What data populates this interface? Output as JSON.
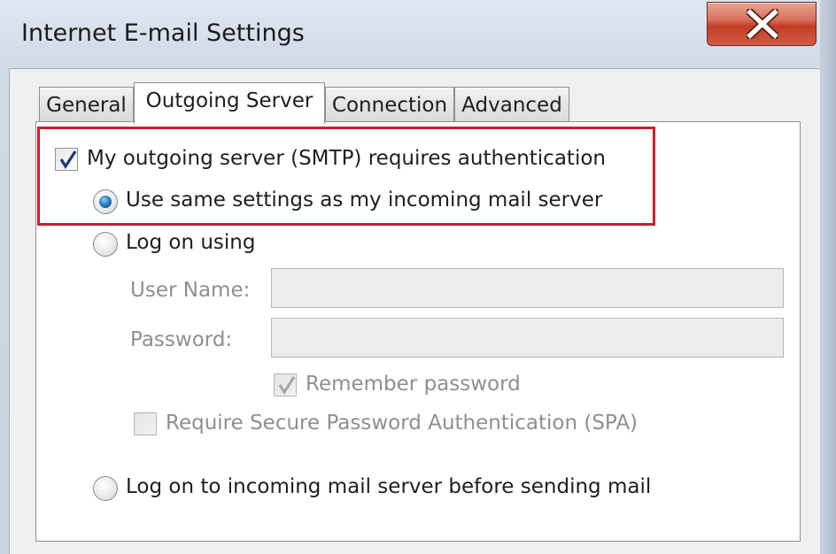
{
  "window": {
    "title": "Internet E-mail Settings",
    "close_icon": "close-icon"
  },
  "tabs": [
    {
      "label": "General",
      "active": false
    },
    {
      "label": "Outgoing Server",
      "active": true
    },
    {
      "label": "Connection",
      "active": false
    },
    {
      "label": "Advanced",
      "active": false
    }
  ],
  "outgoing": {
    "smtp_auth": {
      "label": "My outgoing server (SMTP) requires authentication",
      "checked": true
    },
    "use_same": {
      "label": "Use same settings as my incoming mail server",
      "selected": true
    },
    "log_on_using": {
      "label": "Log on using",
      "selected": false
    },
    "user_name": {
      "label": "User Name:",
      "value": ""
    },
    "password": {
      "label": "Password:",
      "value": ""
    },
    "remember_password": {
      "label": "Remember password",
      "checked": true
    },
    "spa": {
      "label": "Require Secure Password Authentication (SPA)",
      "checked": false
    },
    "log_on_incoming": {
      "label": "Log on to incoming mail server before sending mail",
      "selected": false
    }
  },
  "colors": {
    "highlight": "#c8202e",
    "close_button": "#c43d25",
    "disabled_text": "#8f8f8f"
  }
}
